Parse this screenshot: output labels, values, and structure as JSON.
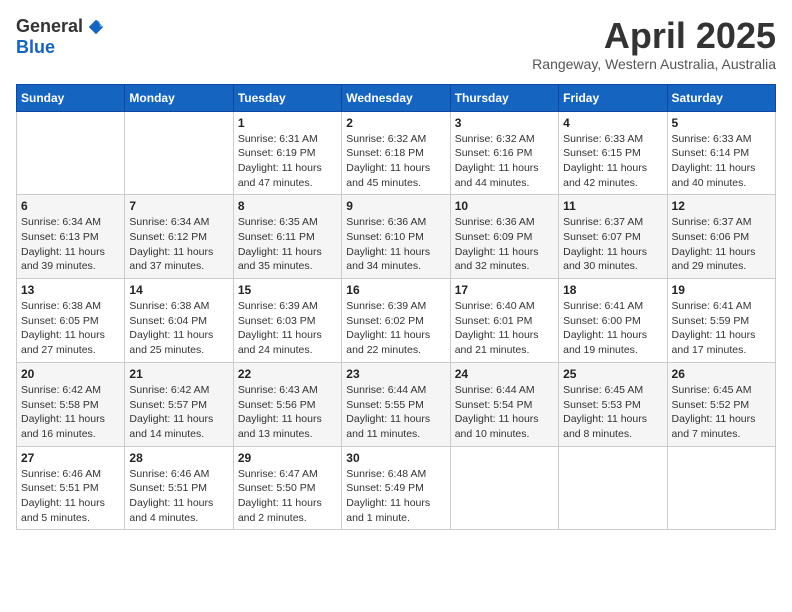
{
  "logo": {
    "general": "General",
    "blue": "Blue"
  },
  "title": "April 2025",
  "subtitle": "Rangeway, Western Australia, Australia",
  "days_header": [
    "Sunday",
    "Monday",
    "Tuesday",
    "Wednesday",
    "Thursday",
    "Friday",
    "Saturday"
  ],
  "weeks": [
    [
      {
        "day": "",
        "sunrise": "",
        "sunset": "",
        "daylight": ""
      },
      {
        "day": "",
        "sunrise": "",
        "sunset": "",
        "daylight": ""
      },
      {
        "day": "1",
        "sunrise": "Sunrise: 6:31 AM",
        "sunset": "Sunset: 6:19 PM",
        "daylight": "Daylight: 11 hours and 47 minutes."
      },
      {
        "day": "2",
        "sunrise": "Sunrise: 6:32 AM",
        "sunset": "Sunset: 6:18 PM",
        "daylight": "Daylight: 11 hours and 45 minutes."
      },
      {
        "day": "3",
        "sunrise": "Sunrise: 6:32 AM",
        "sunset": "Sunset: 6:16 PM",
        "daylight": "Daylight: 11 hours and 44 minutes."
      },
      {
        "day": "4",
        "sunrise": "Sunrise: 6:33 AM",
        "sunset": "Sunset: 6:15 PM",
        "daylight": "Daylight: 11 hours and 42 minutes."
      },
      {
        "day": "5",
        "sunrise": "Sunrise: 6:33 AM",
        "sunset": "Sunset: 6:14 PM",
        "daylight": "Daylight: 11 hours and 40 minutes."
      }
    ],
    [
      {
        "day": "6",
        "sunrise": "Sunrise: 6:34 AM",
        "sunset": "Sunset: 6:13 PM",
        "daylight": "Daylight: 11 hours and 39 minutes."
      },
      {
        "day": "7",
        "sunrise": "Sunrise: 6:34 AM",
        "sunset": "Sunset: 6:12 PM",
        "daylight": "Daylight: 11 hours and 37 minutes."
      },
      {
        "day": "8",
        "sunrise": "Sunrise: 6:35 AM",
        "sunset": "Sunset: 6:11 PM",
        "daylight": "Daylight: 11 hours and 35 minutes."
      },
      {
        "day": "9",
        "sunrise": "Sunrise: 6:36 AM",
        "sunset": "Sunset: 6:10 PM",
        "daylight": "Daylight: 11 hours and 34 minutes."
      },
      {
        "day": "10",
        "sunrise": "Sunrise: 6:36 AM",
        "sunset": "Sunset: 6:09 PM",
        "daylight": "Daylight: 11 hours and 32 minutes."
      },
      {
        "day": "11",
        "sunrise": "Sunrise: 6:37 AM",
        "sunset": "Sunset: 6:07 PM",
        "daylight": "Daylight: 11 hours and 30 minutes."
      },
      {
        "day": "12",
        "sunrise": "Sunrise: 6:37 AM",
        "sunset": "Sunset: 6:06 PM",
        "daylight": "Daylight: 11 hours and 29 minutes."
      }
    ],
    [
      {
        "day": "13",
        "sunrise": "Sunrise: 6:38 AM",
        "sunset": "Sunset: 6:05 PM",
        "daylight": "Daylight: 11 hours and 27 minutes."
      },
      {
        "day": "14",
        "sunrise": "Sunrise: 6:38 AM",
        "sunset": "Sunset: 6:04 PM",
        "daylight": "Daylight: 11 hours and 25 minutes."
      },
      {
        "day": "15",
        "sunrise": "Sunrise: 6:39 AM",
        "sunset": "Sunset: 6:03 PM",
        "daylight": "Daylight: 11 hours and 24 minutes."
      },
      {
        "day": "16",
        "sunrise": "Sunrise: 6:39 AM",
        "sunset": "Sunset: 6:02 PM",
        "daylight": "Daylight: 11 hours and 22 minutes."
      },
      {
        "day": "17",
        "sunrise": "Sunrise: 6:40 AM",
        "sunset": "Sunset: 6:01 PM",
        "daylight": "Daylight: 11 hours and 21 minutes."
      },
      {
        "day": "18",
        "sunrise": "Sunrise: 6:41 AM",
        "sunset": "Sunset: 6:00 PM",
        "daylight": "Daylight: 11 hours and 19 minutes."
      },
      {
        "day": "19",
        "sunrise": "Sunrise: 6:41 AM",
        "sunset": "Sunset: 5:59 PM",
        "daylight": "Daylight: 11 hours and 17 minutes."
      }
    ],
    [
      {
        "day": "20",
        "sunrise": "Sunrise: 6:42 AM",
        "sunset": "Sunset: 5:58 PM",
        "daylight": "Daylight: 11 hours and 16 minutes."
      },
      {
        "day": "21",
        "sunrise": "Sunrise: 6:42 AM",
        "sunset": "Sunset: 5:57 PM",
        "daylight": "Daylight: 11 hours and 14 minutes."
      },
      {
        "day": "22",
        "sunrise": "Sunrise: 6:43 AM",
        "sunset": "Sunset: 5:56 PM",
        "daylight": "Daylight: 11 hours and 13 minutes."
      },
      {
        "day": "23",
        "sunrise": "Sunrise: 6:44 AM",
        "sunset": "Sunset: 5:55 PM",
        "daylight": "Daylight: 11 hours and 11 minutes."
      },
      {
        "day": "24",
        "sunrise": "Sunrise: 6:44 AM",
        "sunset": "Sunset: 5:54 PM",
        "daylight": "Daylight: 11 hours and 10 minutes."
      },
      {
        "day": "25",
        "sunrise": "Sunrise: 6:45 AM",
        "sunset": "Sunset: 5:53 PM",
        "daylight": "Daylight: 11 hours and 8 minutes."
      },
      {
        "day": "26",
        "sunrise": "Sunrise: 6:45 AM",
        "sunset": "Sunset: 5:52 PM",
        "daylight": "Daylight: 11 hours and 7 minutes."
      }
    ],
    [
      {
        "day": "27",
        "sunrise": "Sunrise: 6:46 AM",
        "sunset": "Sunset: 5:51 PM",
        "daylight": "Daylight: 11 hours and 5 minutes."
      },
      {
        "day": "28",
        "sunrise": "Sunrise: 6:46 AM",
        "sunset": "Sunset: 5:51 PM",
        "daylight": "Daylight: 11 hours and 4 minutes."
      },
      {
        "day": "29",
        "sunrise": "Sunrise: 6:47 AM",
        "sunset": "Sunset: 5:50 PM",
        "daylight": "Daylight: 11 hours and 2 minutes."
      },
      {
        "day": "30",
        "sunrise": "Sunrise: 6:48 AM",
        "sunset": "Sunset: 5:49 PM",
        "daylight": "Daylight: 11 hours and 1 minute."
      },
      {
        "day": "",
        "sunrise": "",
        "sunset": "",
        "daylight": ""
      },
      {
        "day": "",
        "sunrise": "",
        "sunset": "",
        "daylight": ""
      },
      {
        "day": "",
        "sunrise": "",
        "sunset": "",
        "daylight": ""
      }
    ]
  ]
}
